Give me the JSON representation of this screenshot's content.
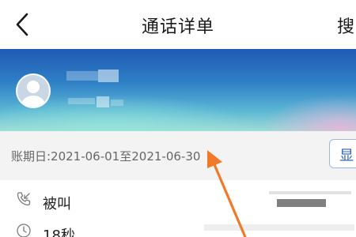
{
  "header": {
    "title": "通话详单",
    "search_label": "搜"
  },
  "billing": {
    "period_text": "账期日:2021-06-01至2021-06-30",
    "show_button_label": "显"
  },
  "call_record": {
    "type": "被叫",
    "duration": "18秒"
  },
  "colors": {
    "banner_top": "#1f5ab4",
    "banner_bottom": "#9fdcd6",
    "accent_blue": "#2f63b8",
    "annotation_arrow": "#f07a28"
  },
  "icons": {
    "back": "chevron-left-icon",
    "avatar": "user-avatar-icon",
    "call_in": "incoming-call-icon",
    "duration": "clock-icon"
  }
}
